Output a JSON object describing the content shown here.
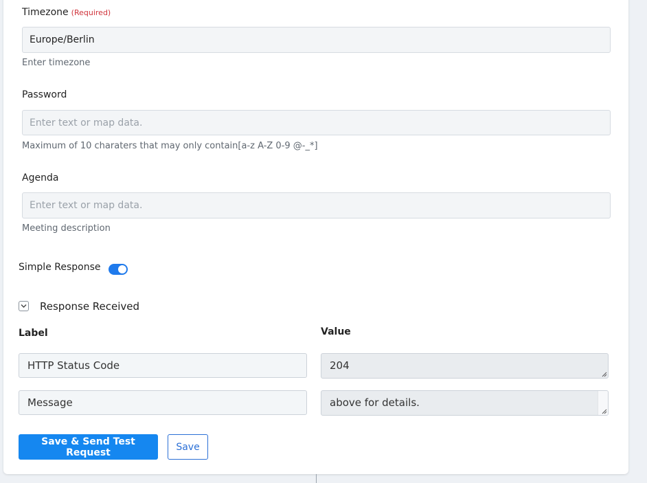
{
  "form": {
    "timezone": {
      "label": "Timezone",
      "required": "(Required)",
      "value": "Europe/Berlin",
      "hint": "Enter timezone"
    },
    "password": {
      "label": "Password",
      "placeholder": "Enter text or map data.",
      "hint": "Maximum of 10 charaters that may only contain[a-z A-Z 0-9 @-_*]"
    },
    "agenda": {
      "label": "Agenda",
      "placeholder": "Enter text or map data.",
      "hint": "Meeting description"
    },
    "simple_response": {
      "label": "Simple Response",
      "enabled": true
    }
  },
  "response": {
    "title": "Response Received",
    "label_header": "Label",
    "value_header": "Value",
    "rows": [
      {
        "label": "HTTP Status Code",
        "value": "204"
      },
      {
        "label": "Message",
        "value": "above for details."
      }
    ]
  },
  "buttons": {
    "save_send": "Save & Send Test Request",
    "save": "Save"
  },
  "colors": {
    "primary": "#1587f0",
    "toggle": "#1f7aec",
    "required": "#d0333b"
  }
}
